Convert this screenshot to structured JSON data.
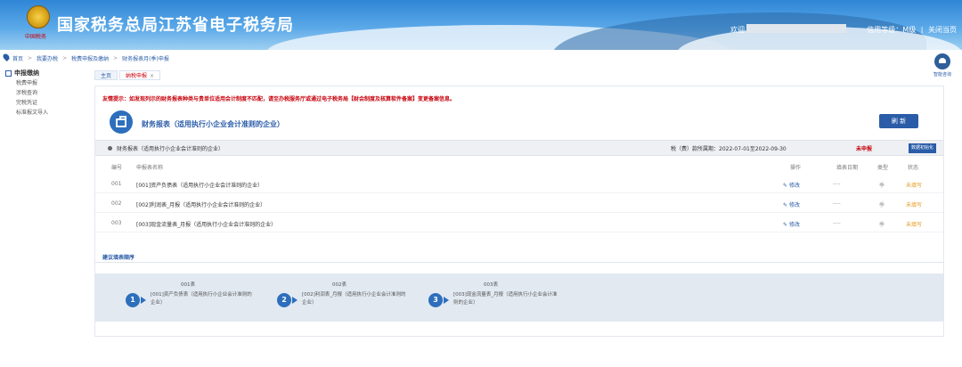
{
  "header": {
    "emblem_text": "中国税务",
    "site_title": "国家税务总局江苏省电子税务局",
    "welcome": "欢迎",
    "credit_level": "信用等级：M级",
    "divider": "|",
    "close_page": "关闭当页"
  },
  "breadcrumb": [
    "首页",
    "我要办税",
    "税费申报及缴纳",
    "财务报表月(季)申报"
  ],
  "breadcrumb_sep": ">",
  "sidebar": {
    "section": "申报缴纳",
    "items": [
      "税费申报",
      "涉税查询",
      "完税凭证",
      "标准报文导入"
    ]
  },
  "tabs": [
    {
      "label": "主页"
    },
    {
      "label": "纳税申报",
      "close": "×"
    }
  ],
  "help": {
    "label": "智能咨询"
  },
  "main": {
    "notice": "友情提示：如发现列示的财务报表种类与贵单位适用会计制度不匹配，请至办税服务厅或通过电子税务局【财会制度及核算软件备案】变更备案信息。",
    "form_title": "财务报表（适用执行小企业会计准则的企业）",
    "refresh": "刷 新",
    "section_title": "财务报表（适用执行小企业会计准则的企业）",
    "period": "税（费）款所属期：2022-07-01至2022-09-30",
    "unfiled": "未申报",
    "init_button": "数据初始化",
    "columns": {
      "no": "编号",
      "name": "申报表名称",
      "op": "操作",
      "date": "填表日期",
      "type": "类型",
      "status": "状态"
    },
    "rows": [
      {
        "no": "001",
        "name": "[001]资产负债表（适用执行小企业会计准则的企业）",
        "op": "修改",
        "date": "----",
        "type": "季",
        "status": "未填写"
      },
      {
        "no": "002",
        "name": "[002]利润表_月报（适用执行小企业会计准则的企业）",
        "op": "修改",
        "date": "----",
        "type": "季",
        "status": "未填写"
      },
      {
        "no": "003",
        "name": "[003]现金流量表_月报（适用执行小企业会计准则的企业）",
        "op": "修改",
        "date": "----",
        "type": "季",
        "status": "未填写"
      }
    ],
    "suggest_title": "建议填表顺序",
    "steps": [
      {
        "num": "1",
        "head": "001表",
        "name": "[001]资产负债表（适用执行小企业会计准则的企业）"
      },
      {
        "num": "2",
        "head": "002表",
        "name": "[002]利润表_月报（适用执行小企业会计准则的企业）"
      },
      {
        "num": "3",
        "head": "003表",
        "name": "[003]现金流量表_月报（适用执行小企业会计准则的企业）"
      }
    ]
  },
  "colors": {
    "primary": "#2a5ca8",
    "alert": "#c7000b",
    "pending": "#e59b1c",
    "step_bg": "#e2e9f1"
  }
}
